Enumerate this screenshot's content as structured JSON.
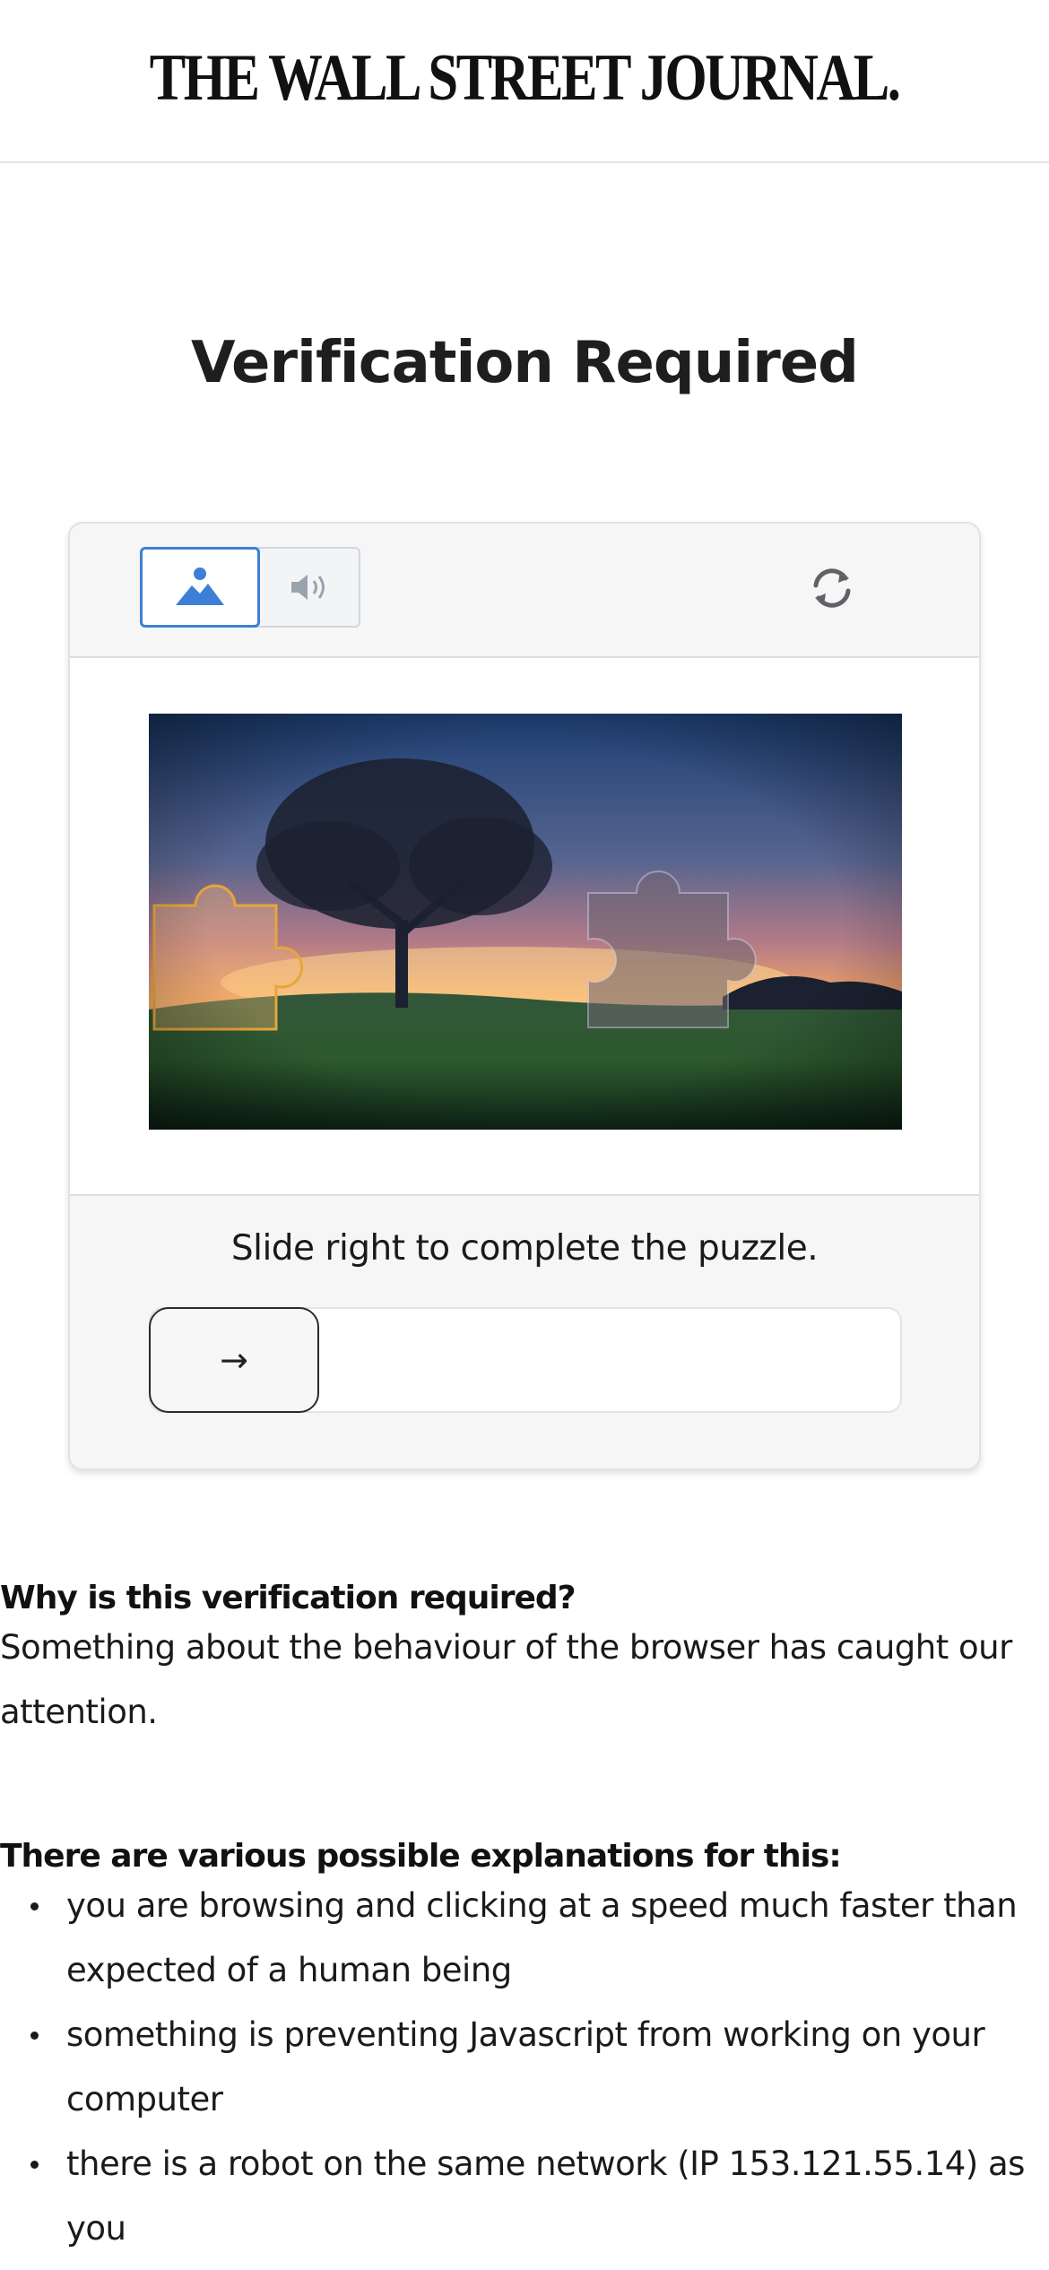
{
  "masthead": {
    "logo_text": "THE WALL STREET JOURNAL."
  },
  "page": {
    "title": "Verification Required"
  },
  "captcha": {
    "modes": [
      {
        "name": "image",
        "icon": "image-icon",
        "selected": true
      },
      {
        "name": "audio",
        "icon": "speaker-icon",
        "selected": false
      }
    ],
    "refresh_icon": "refresh-icon",
    "instruction": "Slide right to complete the puzzle.",
    "slider": {
      "handle_icon": "arrow-right-icon",
      "handle_glyph": "→",
      "progress": 0
    },
    "colors": {
      "accent": "#3d7fd6",
      "piece_outline": "#e7a63a"
    }
  },
  "info": {
    "why_heading": "Why is this verification required?",
    "why_text": "Something about the behaviour of the browser has caught our attention.",
    "reasons_heading": "There are various possible explanations for this:",
    "reasons": [
      "you are browsing and clicking at a speed much faster than expected of a human being",
      "something is preventing Javascript from working on your computer",
      "there is a robot on the same network (IP 153.121.55.14) as you"
    ]
  }
}
